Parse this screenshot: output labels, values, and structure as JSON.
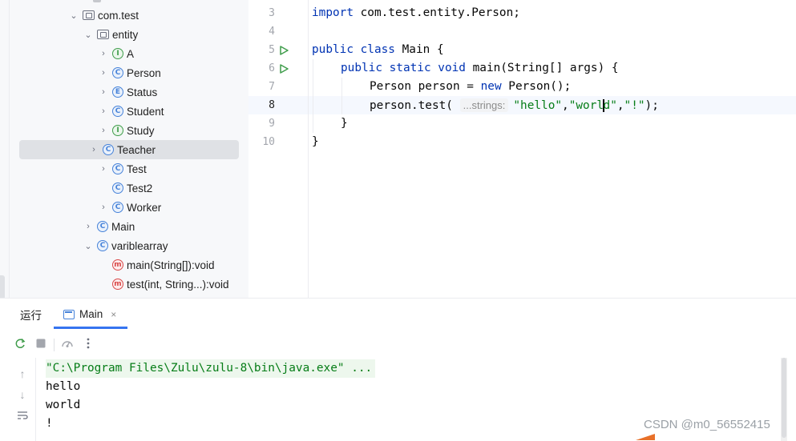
{
  "tree": {
    "items": [
      {
        "label": "com.test",
        "kind": "folder",
        "expanded": true
      },
      {
        "label": "entity",
        "kind": "folder",
        "expanded": true
      },
      {
        "label": "A",
        "kind": "interface",
        "glyph": "I"
      },
      {
        "label": "Person",
        "kind": "class",
        "glyph": "C"
      },
      {
        "label": "Status",
        "kind": "enum",
        "glyph": "E"
      },
      {
        "label": "Student",
        "kind": "class",
        "glyph": "C"
      },
      {
        "label": "Study",
        "kind": "interface",
        "glyph": "I"
      },
      {
        "label": "Teacher",
        "kind": "class",
        "glyph": "C",
        "selected": true
      },
      {
        "label": "Test",
        "kind": "class",
        "glyph": "C"
      },
      {
        "label": "Test2",
        "kind": "class",
        "glyph": "C"
      },
      {
        "label": "Worker",
        "kind": "class",
        "glyph": "C"
      },
      {
        "label": "Main",
        "kind": "class",
        "glyph": "C"
      },
      {
        "label": "variblearray",
        "kind": "class",
        "glyph": "C",
        "expanded": true
      },
      {
        "label": "main(String[]):void",
        "kind": "method",
        "glyph": "m"
      },
      {
        "label": "test(int, String...):void",
        "kind": "method",
        "glyph": "m"
      }
    ]
  },
  "editor": {
    "line_numbers": [
      "3",
      "4",
      "5",
      "6",
      "7",
      "8",
      "9",
      "10"
    ],
    "lines": {
      "l3_import_kw": "import",
      "l3_import_path": " com.test.entity.Person;",
      "l5_kw": "public class",
      "l5_rest": " Main {",
      "l6_kw": "public static void",
      "l6_rest": " main(String[] args) {",
      "l7_a": "Person person = ",
      "l7_kw": "new",
      "l7_b": " Person();",
      "l8_a": "person.test( ",
      "l8_hint": "...strings:",
      "l8_s1": "\"hello\"",
      "l8_c1": ",",
      "l8_s2a": "\"worl",
      "l8_s2b": "d\"",
      "l8_c2": ",",
      "l8_s3": "\"!\"",
      "l8_end": ");",
      "l9": "}",
      "l10": "}"
    }
  },
  "panel": {
    "run_label": "运行",
    "tab_label": "Main",
    "tab_close": "×",
    "console": {
      "command": "\"C:\\Program Files\\Zulu\\zulu-8\\bin\\java.exe\" ...",
      "output": [
        "hello",
        "world",
        "!"
      ]
    }
  },
  "watermark": "CSDN @m0_56552415",
  "colors": {
    "keyword": "#0033b3",
    "string": "#067d17",
    "accent": "#3574f0",
    "run_icon": "#3e9c4a"
  }
}
